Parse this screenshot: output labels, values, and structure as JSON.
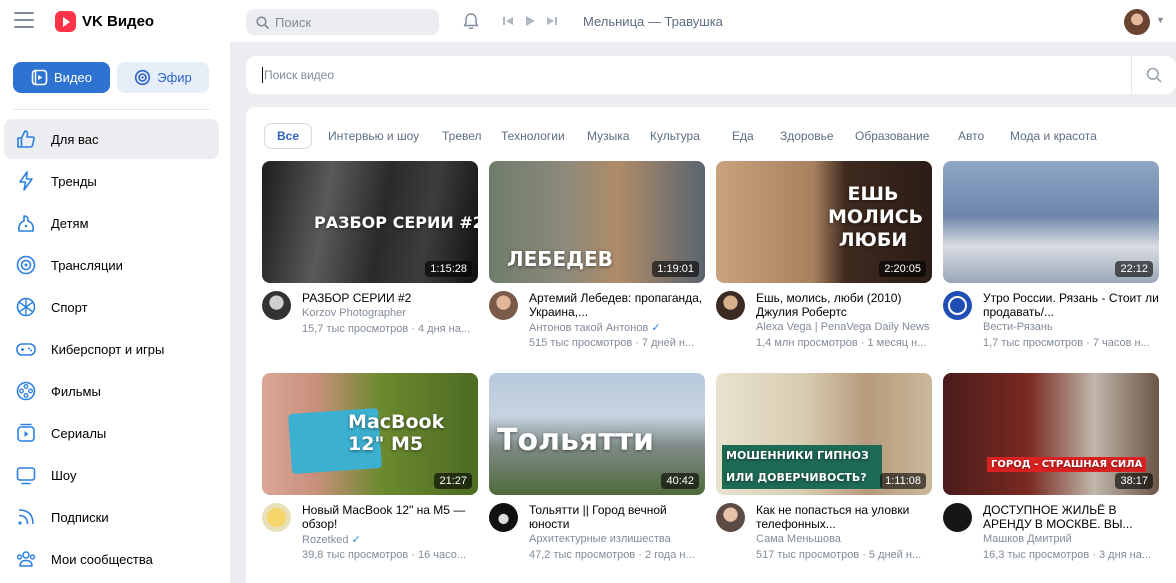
{
  "header": {
    "logo_text": "VK Видео",
    "search_placeholder": "Поиск",
    "now_playing": "Мельница — Травушка"
  },
  "sidebar": {
    "tabs": [
      {
        "label": "Видео",
        "active": true
      },
      {
        "label": "Эфир",
        "active": false
      }
    ],
    "items": [
      {
        "label": "Для вас",
        "icon": "thumbs-up-icon",
        "active": true
      },
      {
        "label": "Тренды",
        "icon": "lightning-icon"
      },
      {
        "label": "Детям",
        "icon": "kid-icon"
      },
      {
        "label": "Трансляции",
        "icon": "broadcast-icon"
      },
      {
        "label": "Спорт",
        "icon": "ball-icon"
      },
      {
        "label": "Киберспорт и игры",
        "icon": "gamepad-icon"
      },
      {
        "label": "Фильмы",
        "icon": "film-reel-icon"
      },
      {
        "label": "Сериалы",
        "icon": "series-icon"
      },
      {
        "label": "Шоу",
        "icon": "tv-icon"
      },
      {
        "label": "Подписки",
        "icon": "rss-icon"
      },
      {
        "label": "Мои сообщества",
        "icon": "community-icon"
      }
    ]
  },
  "video_search": {
    "placeholder": "Поиск видео"
  },
  "categories": [
    "Все",
    "Интервью и шоу",
    "Тревел",
    "Технологии",
    "Музыка",
    "Культура",
    "Еда",
    "Здоровье",
    "Образование",
    "Авто",
    "Мода и красота"
  ],
  "videos": [
    {
      "overlay": "РАЗБОР СЕРИИ #2",
      "duration": "1:15:28",
      "title": "РАЗБОР СЕРИИ #2",
      "channel": "Korzov Photographer",
      "verified": false,
      "stats": "15,7 тыс просмотров · 4 дня на..."
    },
    {
      "overlay": "ЛЕБЕДЕВ",
      "duration": "1:19:01",
      "title": "Артемий Лебедев: пропаганда, Украина,...",
      "channel": "Антонов такой Антонов",
      "verified": true,
      "stats": "515 тыс просмотров · 7 дней н..."
    },
    {
      "overlay": "ЕШЬ МОЛИСЬ ЛЮБИ",
      "duration": "2:20:05",
      "title": "Ешь, молись, люби (2010) Джулия Робертс",
      "channel": "Alexa Vega | PenaVega Daily News",
      "verified": false,
      "stats": "1,4 млн просмотров · 1 месяц н..."
    },
    {
      "overlay": "",
      "duration": "22:12",
      "title": "Утро России. Рязань - Стоит ли продавать/...",
      "channel": "Вести-Рязань",
      "verified": false,
      "stats": "1,7 тыс просмотров · 7 часов н..."
    },
    {
      "overlay": "MacBook 12\" M5",
      "duration": "21:27",
      "title": "Новый MacBook 12\" на M5 — обзор!",
      "channel": "Rozetked",
      "verified": true,
      "stats": "39,8 тыс просмотров · 16 часо..."
    },
    {
      "overlay": "Тольятти",
      "duration": "40:42",
      "title": "Тольятти || Город вечной юности",
      "channel": "Архитектурные излишества",
      "verified": false,
      "stats": "47,2 тыс просмотров · 2 года н..."
    },
    {
      "overlay": "МОШЕННИКИ ГИПНОЗ ИЛИ ДОВЕРЧИВОСТЬ?",
      "duration": "1:11:08",
      "title": "Как не попасться на уловки телефонных...",
      "channel": "Сама Меньшова",
      "verified": false,
      "stats": "517 тыс просмотров · 5 дней н..."
    },
    {
      "overlay": "ГОРОД - СТРАШНАЯ СИЛА",
      "duration": "38:17",
      "title": "ДОСТУПНОЕ ЖИЛЬЁ В АРЕНДУ В МОСКВЕ. ВЫ...",
      "channel": "Машков Дмитрий",
      "verified": false,
      "stats": "16,3 тыс просмотров · 3 дня на..."
    }
  ]
}
